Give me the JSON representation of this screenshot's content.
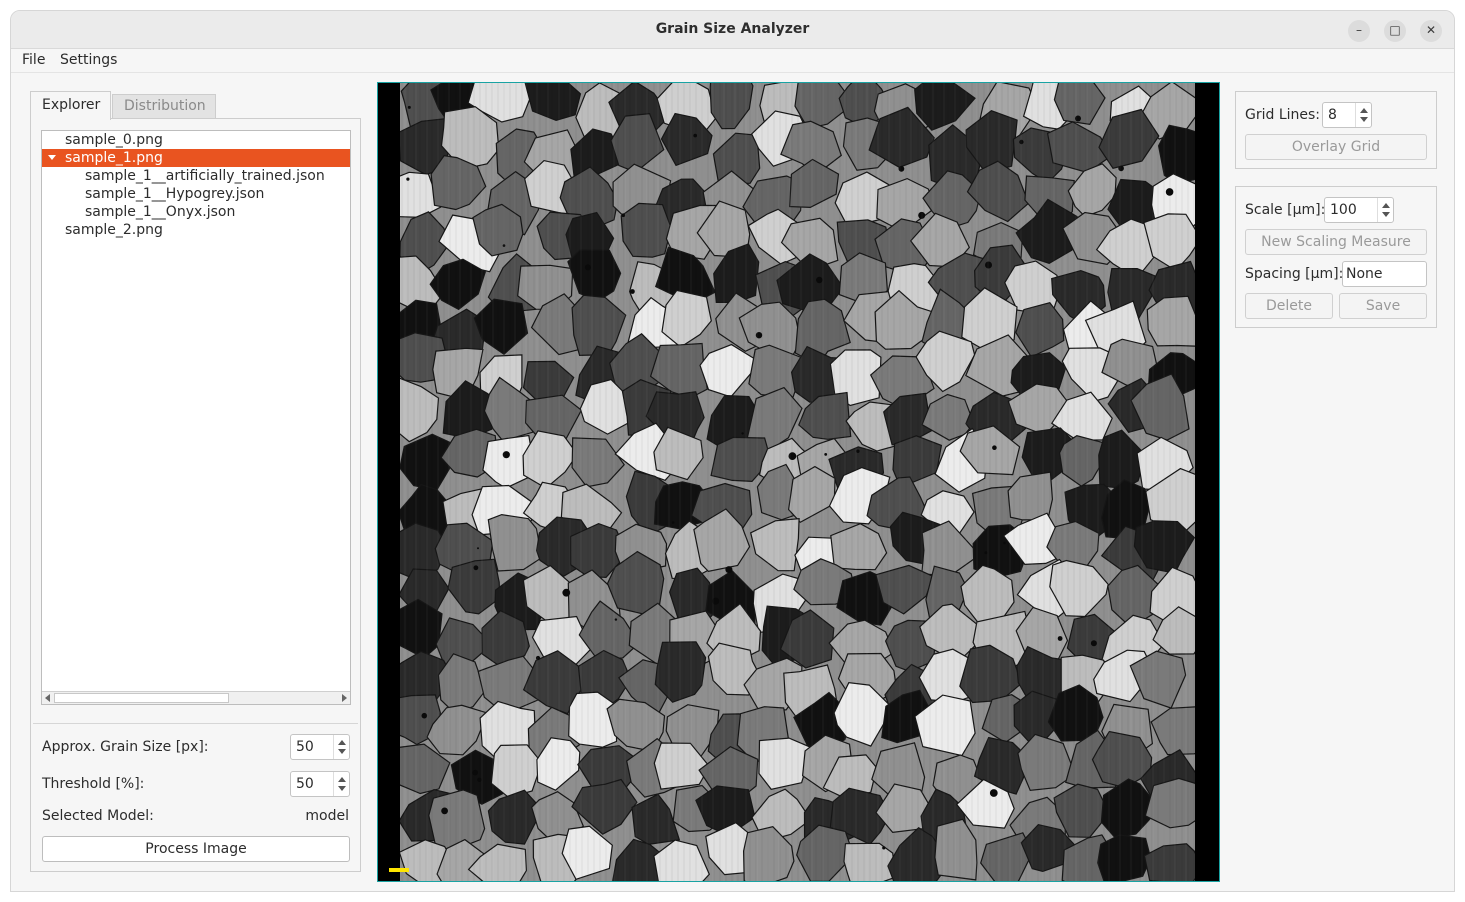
{
  "window": {
    "title": "Grain Size Analyzer",
    "minimize_glyph": "–",
    "maximize_glyph": "□",
    "close_glyph": "✕"
  },
  "menu": {
    "file": "File",
    "settings": "Settings"
  },
  "tabs": {
    "explorer": "Explorer",
    "distribution": "Distribution"
  },
  "tree": {
    "items": [
      {
        "label": "sample_0.png",
        "level": 0,
        "selected": false
      },
      {
        "label": "sample_1.png",
        "level": 0,
        "selected": true,
        "expanded": true
      },
      {
        "label": "sample_1__artificially_trained.json",
        "level": 1,
        "selected": false
      },
      {
        "label": "sample_1__Hypogrey.json",
        "level": 1,
        "selected": false
      },
      {
        "label": "sample_1__Onyx.json",
        "level": 1,
        "selected": false
      },
      {
        "label": "sample_2.png",
        "level": 0,
        "selected": false
      }
    ]
  },
  "params": {
    "grain_size_label": "Approx. Grain Size [px]:",
    "grain_size_value": "50",
    "threshold_label": "Threshold [%]:",
    "threshold_value": "50",
    "model_label": "Selected Model:",
    "model_value": "model",
    "process_button": "Process Image"
  },
  "grid": {
    "label": "Grid Lines:",
    "value": "8",
    "overlay_button": "Overlay Grid"
  },
  "scale": {
    "label": "Scale [µm]:",
    "value": "100",
    "new_measure_button": "New Scaling Measure",
    "spacing_label": "Spacing [µm]:",
    "spacing_value": "None",
    "delete_button": "Delete",
    "save_button": "Save"
  },
  "colors": {
    "selection": "#e95420",
    "viewer_border": "#19a3a3",
    "scale_bar": "#ffe600"
  }
}
